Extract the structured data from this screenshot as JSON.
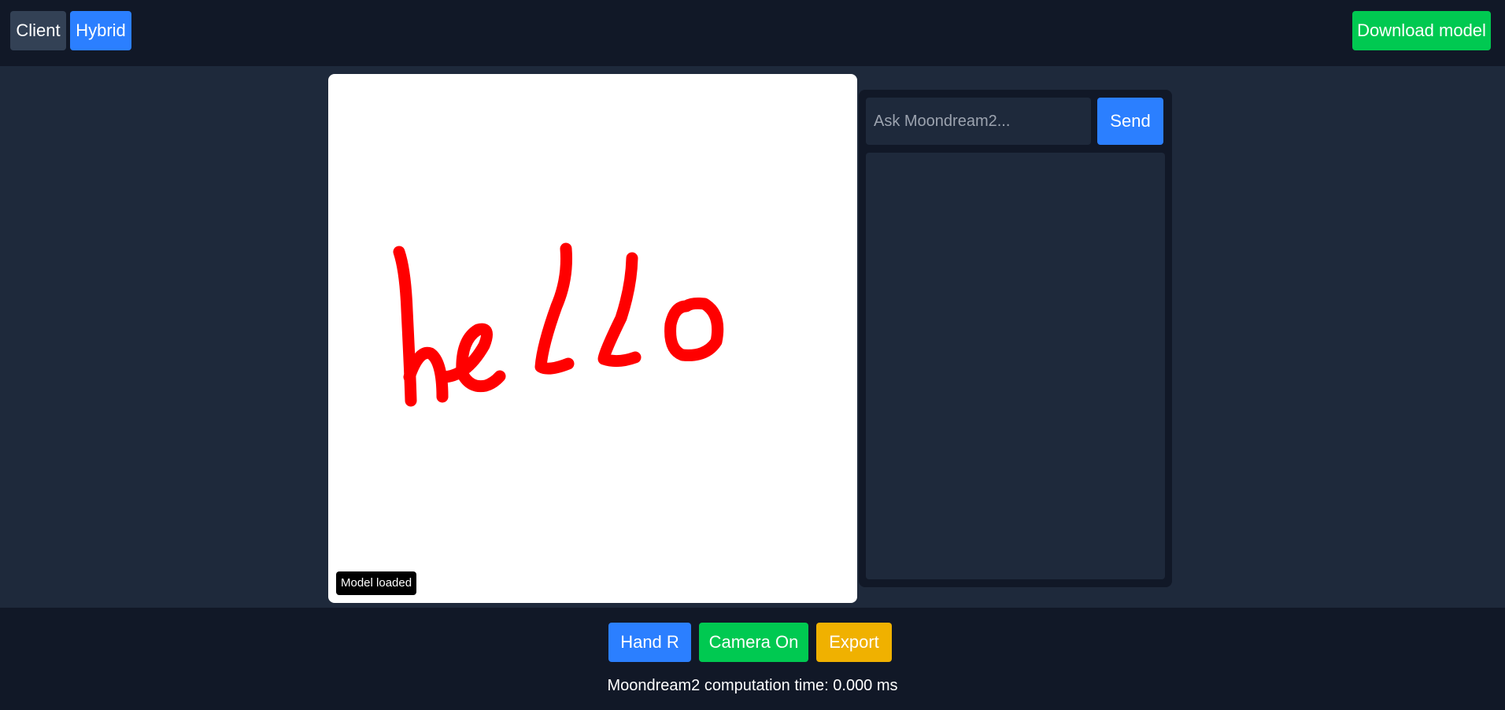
{
  "header": {
    "client_label": "Client",
    "hybrid_label": "Hybrid",
    "download_label": "Download model"
  },
  "canvas": {
    "drawn_text": "hello",
    "stroke_color": "#ff0000",
    "status": "Model loaded"
  },
  "chat": {
    "placeholder": "Ask Moondream2...",
    "send_label": "Send"
  },
  "footer": {
    "hand_label": "Hand R",
    "camera_label": "Camera On",
    "export_label": "Export",
    "timing": "Moondream2 computation time: 0.000 ms"
  },
  "colors": {
    "background": "#1e293b",
    "bar": "#111827",
    "primary": "#2b7fff",
    "success": "#00c951",
    "warning": "#f0b100"
  }
}
